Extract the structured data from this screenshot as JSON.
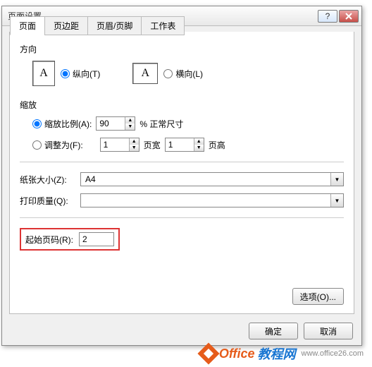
{
  "title": "页面设置",
  "tabs": [
    "页面",
    "页边距",
    "页眉/页脚",
    "工作表"
  ],
  "orientation": {
    "label": "方向",
    "portrait": "纵向(T)",
    "landscape": "横向(L)"
  },
  "scaling": {
    "label": "缩放",
    "ratio_label": "缩放比例(A):",
    "ratio_value": "90",
    "ratio_suffix": "% 正常尺寸",
    "fit_label": "调整为(F):",
    "fit_wide": "1",
    "fit_wide_suffix": "页宽",
    "fit_tall": "1",
    "fit_tall_suffix": "页高"
  },
  "paper": {
    "size_label": "纸张大小(Z):",
    "size_value": "A4",
    "quality_label": "打印质量(Q):",
    "quality_value": ""
  },
  "start_page": {
    "label": "起始页码(R):",
    "value": "2"
  },
  "buttons": {
    "options": "选项(O)...",
    "ok": "确定",
    "cancel": "取消"
  },
  "watermark": {
    "brand1": "Office",
    "brand2": "教程网",
    "url": "www.office26.com"
  }
}
